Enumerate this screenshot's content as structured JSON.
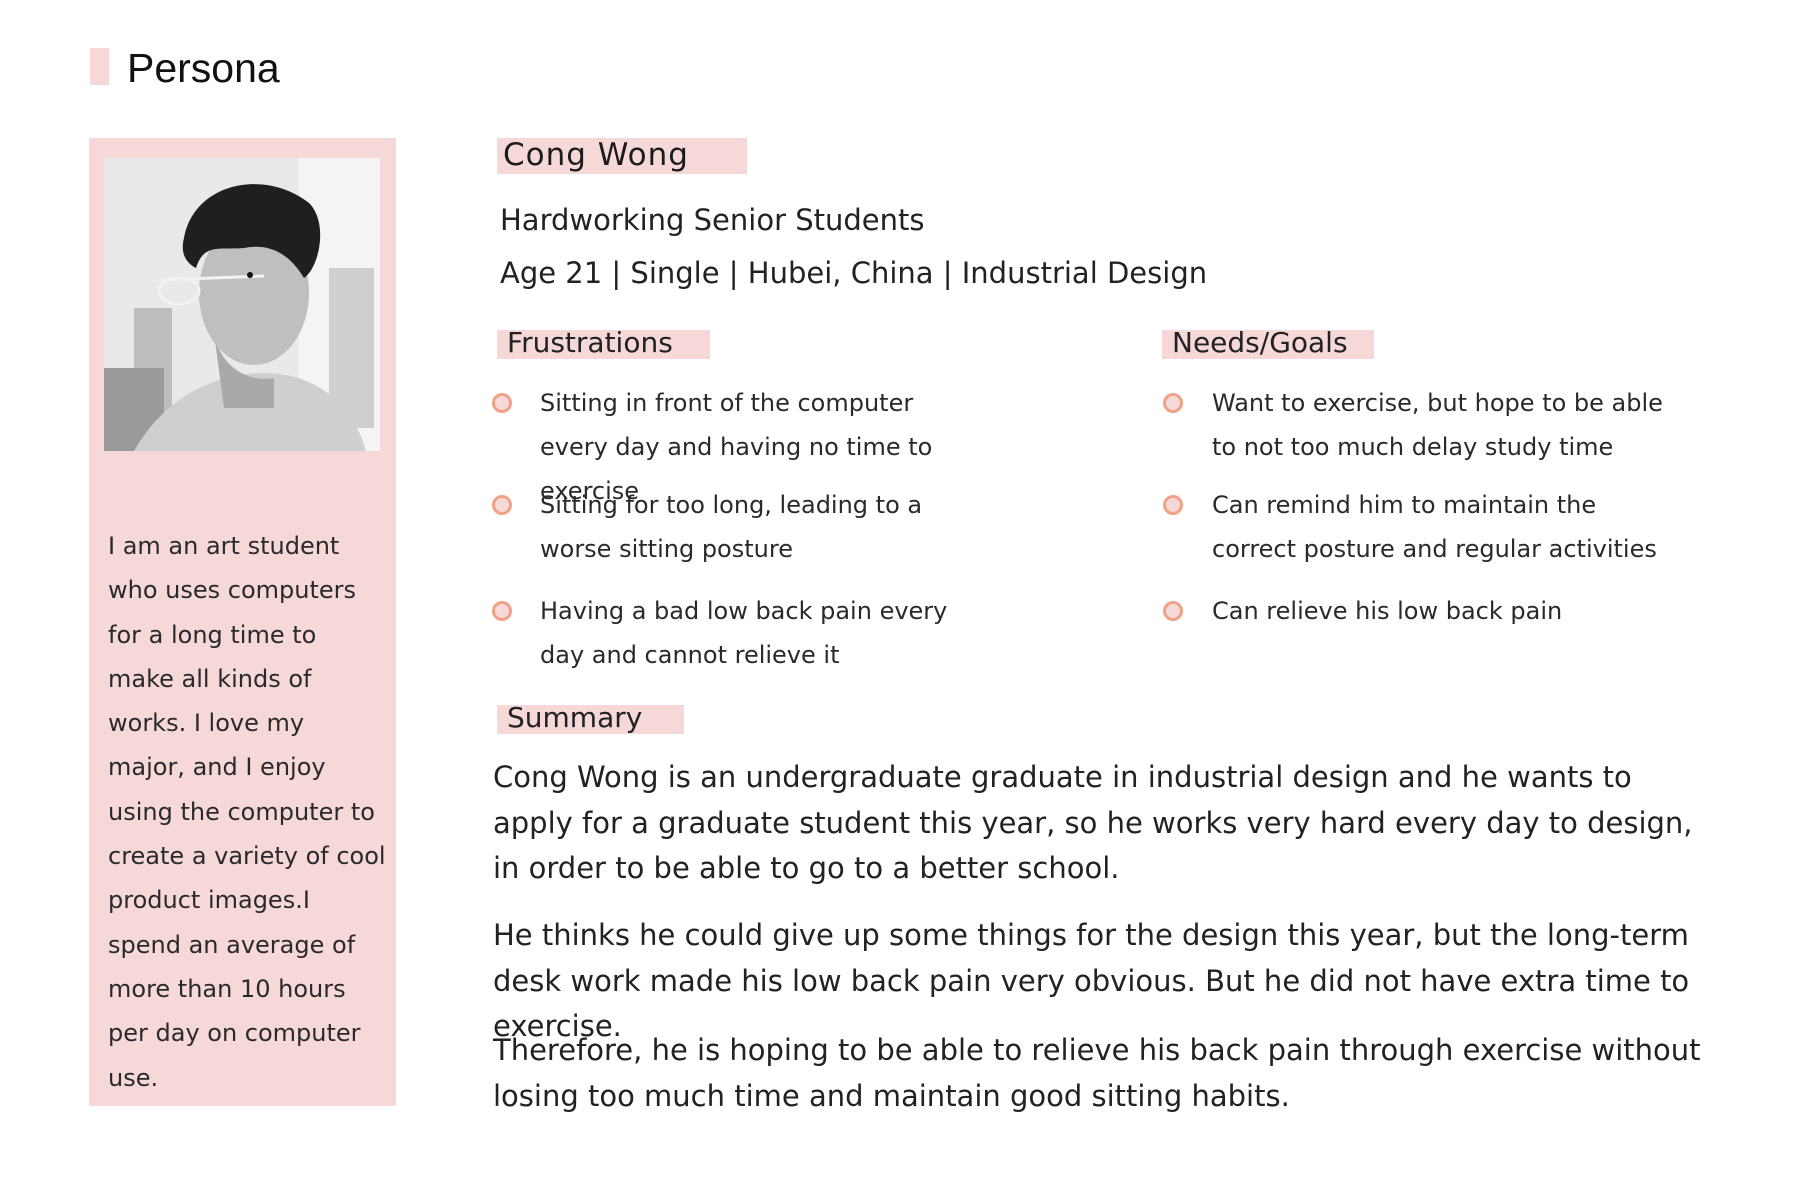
{
  "header": {
    "title": "Persona"
  },
  "persona": {
    "name": "Cong Wong",
    "tagline": "Hardworking Senior Students",
    "meta": "Age 21 | Single | Hubei, China | Industrial Design",
    "bio": "I am an art student who uses computers for a long time to make all kinds of works. I love my major, and I enjoy using the computer to create a variety of cool product images.I spend an average of more than 10 hours per day on computer use."
  },
  "frustrations": {
    "heading": "Frustrations",
    "items": [
      "Sitting in front of the computer every day and having no time to exercise",
      "Sitting for too long, leading to a worse sitting posture",
      "Having a bad low back pain every day and cannot relieve it"
    ]
  },
  "needs": {
    "heading": "Needs/Goals",
    "items": [
      "Want to exercise, but hope to be able to not too much delay study time",
      "Can remind him to maintain the correct posture and regular activities",
      "Can relieve his low back pain"
    ]
  },
  "summary": {
    "heading": "Summary",
    "paragraphs": [
      "Cong Wong is an undergraduate graduate in industrial design and he wants to apply for a graduate student this year, so he works very hard every day to design, in order to be able to go to a better school.",
      "He thinks he could give up some things for the design this year, but the long-term desk work made his low back pain very obvious. But he did not have extra time to exercise.",
      "Therefore, he is hoping to be able to relieve his back pain through exercise without losing too much time and maintain good sitting habits."
    ]
  },
  "colors": {
    "accent_fill": "#f6d8d8",
    "bullet_stroke": "#f0a286"
  }
}
